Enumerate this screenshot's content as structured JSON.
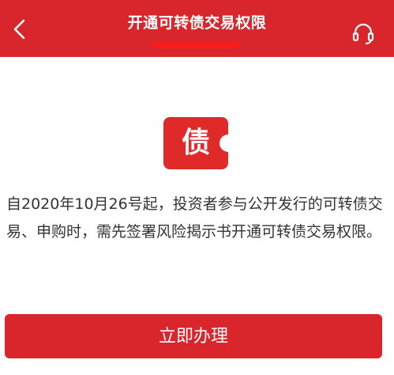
{
  "header": {
    "title": "开通可转债交易权限",
    "back_icon": "chevron-left-icon",
    "service_icon": "headset-icon",
    "bg_color": "#d9262c"
  },
  "badge": {
    "text": "债",
    "icon": "ticket-badge-icon",
    "color": "#e02a2a"
  },
  "notice": {
    "text": "自2020年10月26号起，投资者参与公开发行的可转债交易、申购时，需先签署风险揭示书开通可转债交易权限。"
  },
  "action": {
    "label": "立即办理",
    "color": "#d9262c"
  }
}
